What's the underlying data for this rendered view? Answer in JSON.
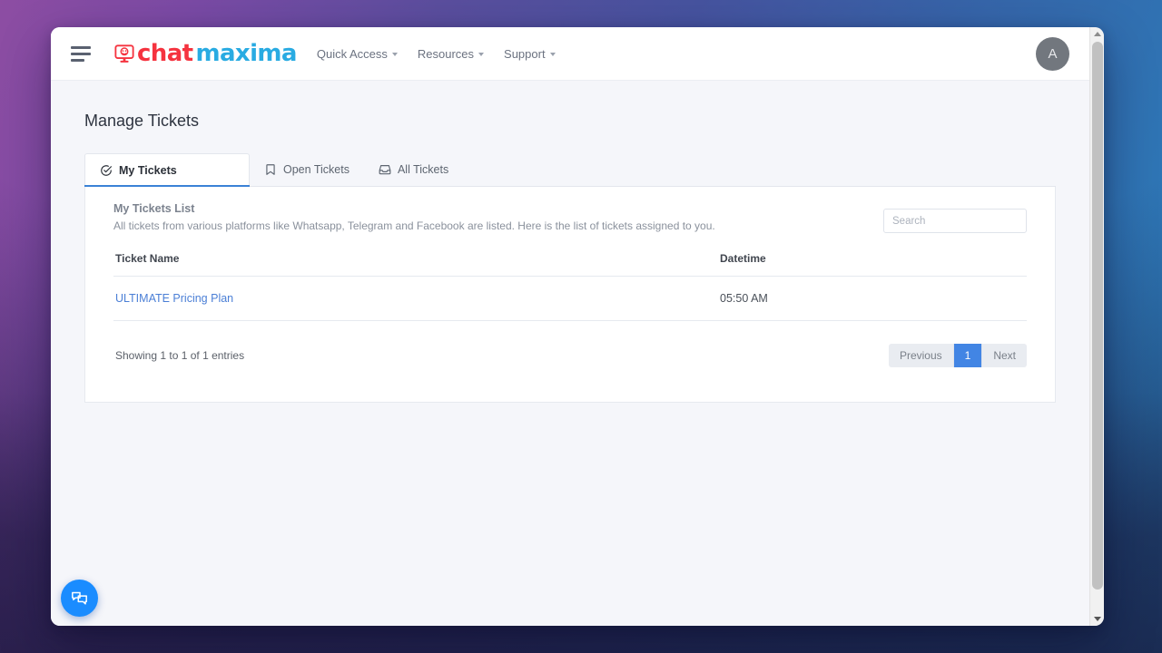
{
  "theme": {
    "accent_blue": "#4285e4",
    "link_blue": "#4b7fd6",
    "logo_red": "#f5333f",
    "logo_blue": "#29abe2",
    "chat_widget_blue": "#1a8cff",
    "page_background": "#f5f6fa",
    "desktop_gradient_from": "#8d4da3",
    "desktop_gradient_to": "#2b80bd"
  },
  "navbar": {
    "menu_icon": "hamburger-icon",
    "logo": {
      "icon": "chatmaxima-monitor-icon",
      "text_primary": "chat",
      "text_secondary": "maxima"
    },
    "links": [
      {
        "label": "Quick Access",
        "icon": "chevron-down-icon"
      },
      {
        "label": "Resources",
        "icon": "chevron-down-icon"
      },
      {
        "label": "Support",
        "icon": "chevron-down-icon"
      }
    ],
    "avatar": {
      "initial": "A",
      "icon": "avatar"
    }
  },
  "page": {
    "title": "Manage Tickets"
  },
  "tabs": [
    {
      "label": "My Tickets",
      "icon": "check-circle-icon",
      "active": true
    },
    {
      "label": "Open Tickets",
      "icon": "bookmark-icon",
      "active": false
    },
    {
      "label": "All Tickets",
      "icon": "inbox-icon",
      "active": false
    }
  ],
  "card": {
    "title": "My Tickets List",
    "description": "All tickets from various platforms like Whatsapp, Telegram and Facebook are listed. Here is the list of tickets assigned to you.",
    "search": {
      "placeholder": "Search",
      "value": "",
      "icon": "search-input"
    }
  },
  "table": {
    "columns": [
      "Ticket Name",
      "Datetime"
    ],
    "rows": [
      {
        "ticket_name": "ULTIMATE Pricing Plan",
        "datetime": "05:50 AM"
      }
    ]
  },
  "footer": {
    "entries_info": "Showing 1 to 1 of 1 entries",
    "pagination": {
      "previous_label": "Previous",
      "pages": [
        "1"
      ],
      "current_page": "1",
      "next_label": "Next"
    }
  },
  "chat_widget": {
    "icon": "chat-bubbles-icon",
    "label": "Open chat"
  },
  "scrollbar": {
    "up_icon": "scroll-up-arrow-icon",
    "down_icon": "scroll-down-arrow-icon"
  }
}
